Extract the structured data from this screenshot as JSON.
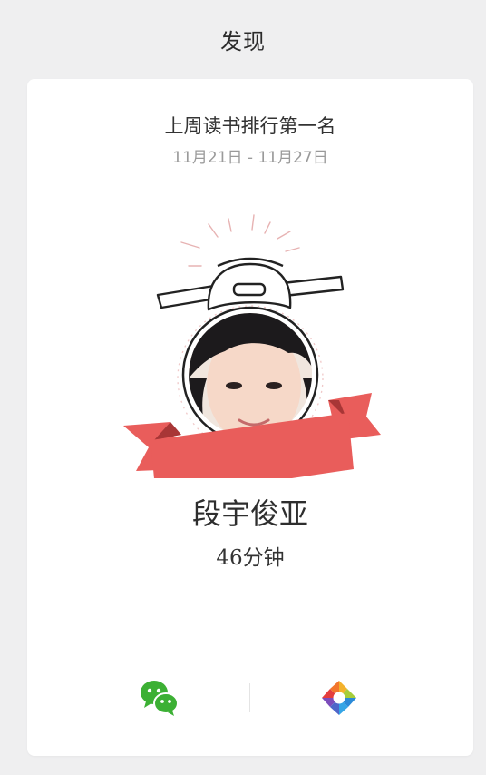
{
  "app_bar": {
    "title": "发现"
  },
  "ranking_card": {
    "heading": "上周读书排行第一名",
    "date_range": "11月21日 - 11月27日",
    "winner": {
      "name": "段宇俊亚",
      "reading_time": "46分钟"
    },
    "colors": {
      "ribbon": "#e95d5b",
      "ribbon_dark": "#c94644"
    }
  },
  "share": {
    "icons": [
      "wechat-icon",
      "moments-icon"
    ]
  }
}
